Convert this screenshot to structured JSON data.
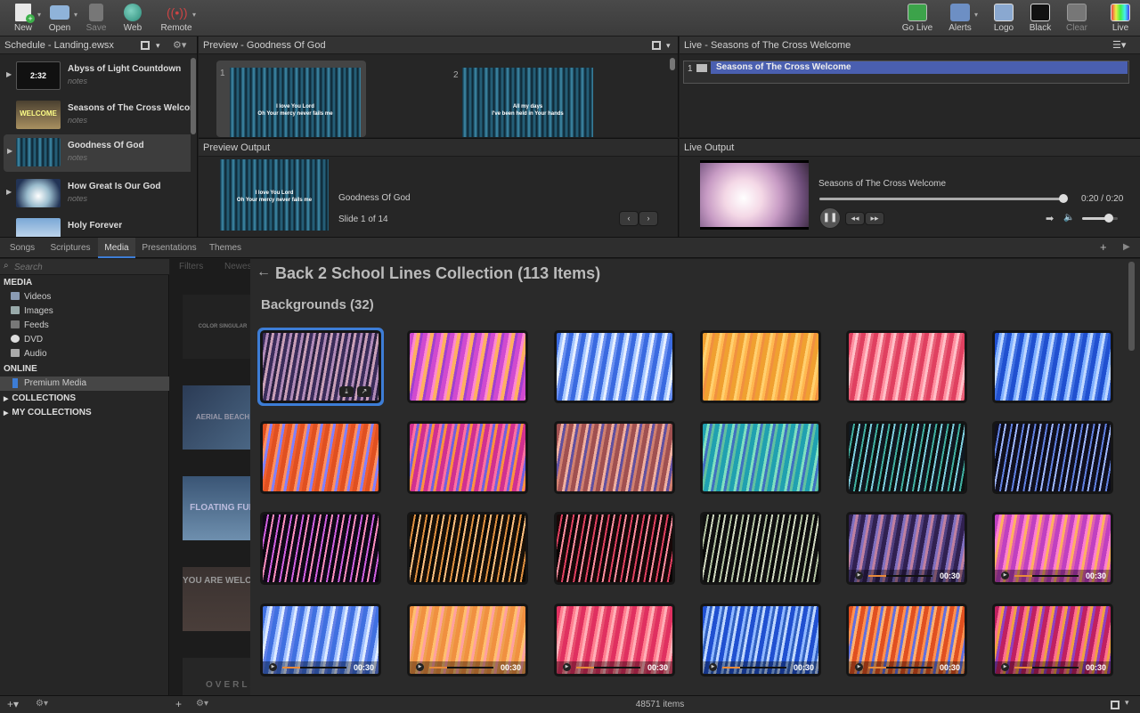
{
  "toolbar": {
    "left": [
      {
        "label": "New"
      },
      {
        "label": "Open"
      },
      {
        "label": "Save"
      },
      {
        "label": "Web"
      },
      {
        "label": "Remote"
      }
    ],
    "right": [
      {
        "label": "Go Live"
      },
      {
        "label": "Alerts"
      },
      {
        "label": "Logo"
      },
      {
        "label": "Black"
      },
      {
        "label": "Clear"
      },
      {
        "label": "Live"
      }
    ]
  },
  "schedule": {
    "title": "Schedule - Landing.ewsx",
    "items": [
      {
        "title": "Abyss of Light Countdown",
        "notes": "notes",
        "thumb_text": "2:32"
      },
      {
        "title": "Seasons of The Cross Welcome",
        "notes": "notes",
        "thumb_text": "WELCOME"
      },
      {
        "title": "Goodness Of God",
        "notes": "notes",
        "thumb_text": ""
      },
      {
        "title": "How Great Is Our God",
        "notes": "notes",
        "thumb_text": ""
      },
      {
        "title": "Holy Forever",
        "notes": "",
        "thumb_text": ""
      }
    ]
  },
  "preview": {
    "title": "Preview - Goodness Of God",
    "slides": [
      {
        "num": "1",
        "line1": "I love You Lord",
        "line2": "Oh Your mercy never fails me"
      },
      {
        "num": "2",
        "line1": "All my days",
        "line2": "I've been held in Your hands"
      }
    ]
  },
  "live": {
    "title": "Live - Seasons of The Cross Welcome",
    "items": [
      {
        "num": "1",
        "label": "Seasons of The Cross Welcome"
      }
    ]
  },
  "preview_output": {
    "title": "Preview Output",
    "song": "Goodness Of God",
    "slide_info": "Slide 1 of 14",
    "line1": "I love You Lord",
    "line2": "Oh Your mercy never fails me"
  },
  "live_output": {
    "title": "Live Output",
    "name": "Seasons of The Cross Welcome",
    "time": "0:20 / 0:20",
    "progress": 1.0,
    "volume": 0.75
  },
  "tabs": [
    "Songs",
    "Scriptures",
    "Media",
    "Presentations",
    "Themes"
  ],
  "sidebar": {
    "search_placeholder": "Search",
    "media_header": "MEDIA",
    "media_items": [
      "Videos",
      "Images",
      "Feeds",
      "DVD",
      "Audio"
    ],
    "online_header": "ONLINE",
    "online_items": [
      "Premium Media"
    ],
    "collections": "COLLECTIONS",
    "my_collections": "MY COLLECTIONS"
  },
  "browser": {
    "filters": "Filters",
    "newest": "Newest",
    "bg_cards": [
      "COLOR SINGULAR",
      "AERIAL BEACH",
      "FLOATING FUN",
      "YOU ARE WELCOME",
      "OVERLAY"
    ]
  },
  "gallery": {
    "title": "Back 2 School Lines Collection (113 Items)",
    "section": "Backgrounds (32)",
    "tiles": [
      {
        "duration": ""
      },
      {
        "duration": ""
      },
      {
        "duration": ""
      },
      {
        "duration": ""
      },
      {
        "duration": ""
      },
      {
        "duration": ""
      },
      {
        "duration": ""
      },
      {
        "duration": ""
      },
      {
        "duration": ""
      },
      {
        "duration": ""
      },
      {
        "duration": ""
      },
      {
        "duration": ""
      },
      {
        "duration": ""
      },
      {
        "duration": ""
      },
      {
        "duration": ""
      },
      {
        "duration": ""
      },
      {
        "duration": "00:30"
      },
      {
        "duration": "00:30"
      },
      {
        "duration": "00:30"
      },
      {
        "duration": "00:30"
      },
      {
        "duration": "00:30"
      },
      {
        "duration": "00:30"
      },
      {
        "duration": "00:30"
      },
      {
        "duration": "00:30"
      }
    ]
  },
  "status": {
    "count": "48571 items"
  },
  "colors": {
    "accent": "#3d7dd6",
    "live_highlight": "#4a5fb0"
  }
}
